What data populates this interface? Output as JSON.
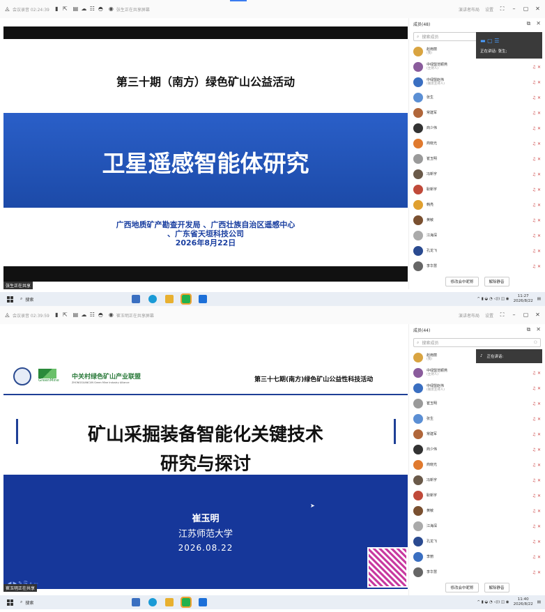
{
  "screen1": {
    "toolbar": {
      "timer": "会议录音 02:24:39",
      "sharing": "张生正在共享屏幕",
      "layout": "演讲者布局",
      "settings": "设置"
    },
    "slide": {
      "title": "第三十期（南方）绿色矿山公益活动",
      "topic": "卫星遥感智能体研究",
      "org1": "广西地质矿产勘查开发局 、广西壮族自治区遥感中心",
      "org2": "、广东省天垣科技公司",
      "date": "2026年8月22日"
    },
    "panel": {
      "header": "成员(48)",
      "search_placeholder": "搜索成员",
      "speaking": "正在讲话: 张生;",
      "rename": "修改会中昵称",
      "unmute": "解除静音"
    },
    "members": [
      {
        "name": "赵雨丽",
        "role": "(我)",
        "color": "#d9a441"
      },
      {
        "name": "中绿盟范颖燕",
        "role": "(主持人)",
        "color": "#8a5c9c"
      },
      {
        "name": "中绿盟赵伟",
        "role": "(联席主持人)",
        "color": "#3a6fc1"
      },
      {
        "name": "张生",
        "role": "",
        "color": "#5b8fd4"
      },
      {
        "name": "常建军",
        "role": "",
        "color": "#b0663a"
      },
      {
        "name": "商少伟",
        "role": "",
        "color": "#333"
      },
      {
        "name": "商晓光",
        "role": "",
        "color": "#e07a2e"
      },
      {
        "name": "崔玉明",
        "role": "",
        "color": "#9a9a9a"
      },
      {
        "name": "冯新宇",
        "role": "",
        "color": "#6a5a4a"
      },
      {
        "name": "耿新宇",
        "role": "",
        "color": "#c04a3a"
      },
      {
        "name": "韩亮",
        "role": "",
        "color": "#e0a030"
      },
      {
        "name": "黄敏",
        "role": "",
        "color": "#7a5030"
      },
      {
        "name": "江海深",
        "role": "",
        "color": "#aaa"
      },
      {
        "name": "孔龙飞",
        "role": "",
        "color": "#2a4a90"
      },
      {
        "name": "李华慧",
        "role": "",
        "color": "#666"
      }
    ],
    "share_label": "张生正在共享",
    "task": {
      "search": "搜索",
      "time": "11:27",
      "date": "2026/8/22"
    }
  },
  "screen2": {
    "toolbar": {
      "timer": "会议录音 02:39:59",
      "sharing": "崔玉明正在共享屏幕",
      "layout": "演讲者布局",
      "settings": "设置"
    },
    "slide": {
      "logo_text": "中关村绿色矿山产业联盟",
      "logo_sub": "ZHONGGUANCUN Green Mine Industry Alliance",
      "logo_brand": "GreenMine",
      "event": "第三十七期(南方)绿色矿山公益性科技活动",
      "title1": "矿山采掘装备智能化关键技术",
      "title2": "研究与探讨",
      "speaker": "崔玉明",
      "univ": "江苏师范大学",
      "date": "2026.08.22"
    },
    "panel": {
      "header": "成员(44)",
      "search_placeholder": "搜索成员",
      "speaking": "正在讲话:",
      "rename": "修改会中昵称",
      "unmute": "解除静音"
    },
    "members": [
      {
        "name": "赵雨丽",
        "role": "(我)",
        "color": "#d9a441"
      },
      {
        "name": "中绿盟范颖燕",
        "role": "(主持人)",
        "color": "#8a5c9c"
      },
      {
        "name": "中绿盟赵伟",
        "role": "(联席主持人)",
        "color": "#3a6fc1"
      },
      {
        "name": "崔玉明",
        "role": "",
        "color": "#9a9a9a"
      },
      {
        "name": "张生",
        "role": "",
        "color": "#5b8fd4"
      },
      {
        "name": "常建军",
        "role": "",
        "color": "#b0663a"
      },
      {
        "name": "商少伟",
        "role": "",
        "color": "#333"
      },
      {
        "name": "商晓光",
        "role": "",
        "color": "#e07a2e"
      },
      {
        "name": "冯新宇",
        "role": "",
        "color": "#6a5a4a"
      },
      {
        "name": "耿新宇",
        "role": "",
        "color": "#c04a3a"
      },
      {
        "name": "黄敏",
        "role": "",
        "color": "#7a5030"
      },
      {
        "name": "江海深",
        "role": "",
        "color": "#aaa"
      },
      {
        "name": "孔龙飞",
        "role": "",
        "color": "#2a4a90"
      },
      {
        "name": "李丽",
        "role": "",
        "color": "#3a6fc1"
      },
      {
        "name": "李华慧",
        "role": "",
        "color": "#666"
      }
    ],
    "share_label": "崔玉明正在共享",
    "task": {
      "search": "搜索",
      "time": "11:40",
      "date": "2026/8/22"
    }
  }
}
